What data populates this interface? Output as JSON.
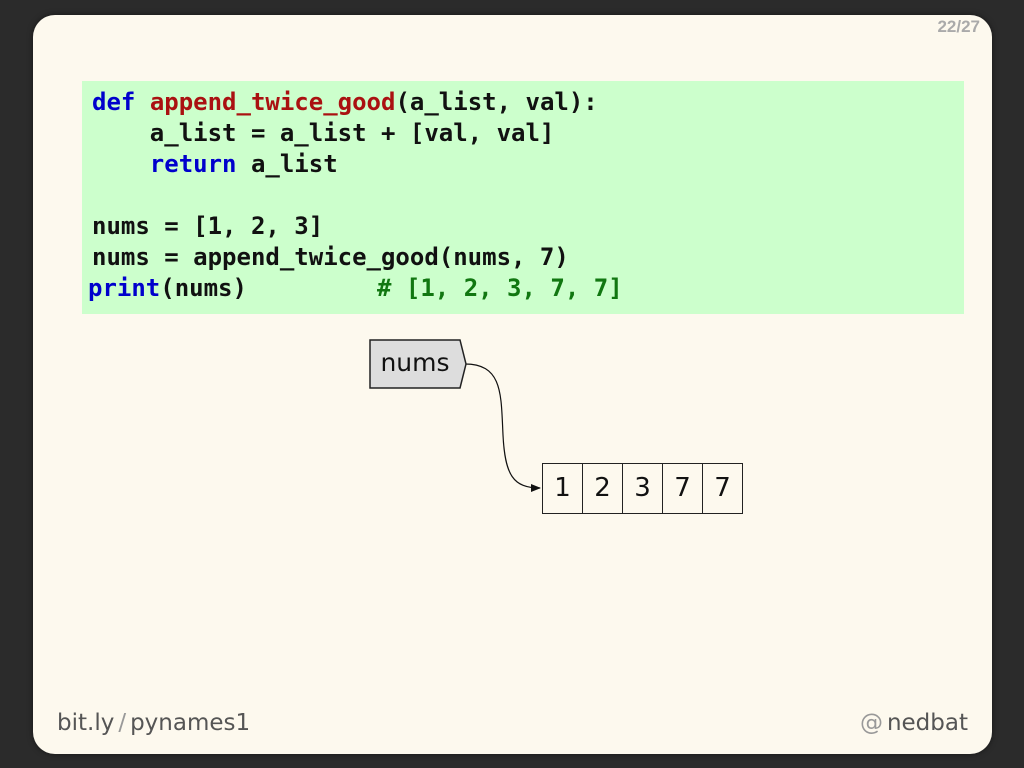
{
  "slide_number": "22/27",
  "code": {
    "line1": {
      "kw": "def",
      "fn": "append_twice_good",
      "rest": "(a_list, val):"
    },
    "line2": "    a_list = a_list + [val, val]",
    "line3": {
      "indent": "    ",
      "kw": "return",
      "rest": " a_list"
    },
    "line5": "nums = [1, 2, 3]",
    "line6": "nums = append_twice_good(nums, 7)",
    "line7": {
      "kw": "print",
      "rest": "(nums)         ",
      "comment": "# [1, 2, 3, 7, 7]"
    }
  },
  "diagram": {
    "name_label": "nums",
    "list_values": [
      "1",
      "2",
      "3",
      "7",
      "7"
    ]
  },
  "footer": {
    "left_domain": "bit.ly",
    "left_sep": "/",
    "left_path": "pynames1",
    "right_at": "@",
    "right_handle": "nedbat"
  },
  "colors": {
    "code_background": "#ccffcc",
    "keyword": "#0000cc",
    "function_name": "#aa1111",
    "comment": "#117711",
    "name_box_fill": "#dddddd",
    "slide_background": "#fdf9ee"
  }
}
